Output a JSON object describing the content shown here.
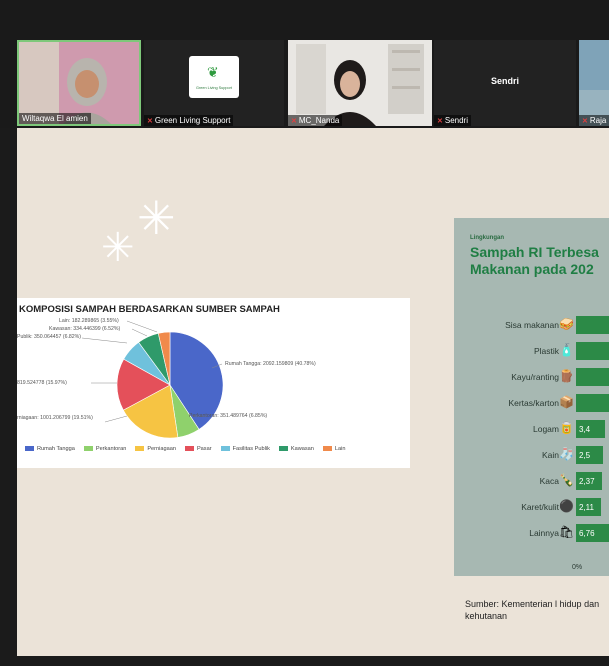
{
  "participants": [
    {
      "name": "Wiltaqwa El amien",
      "muted": false,
      "active": true
    },
    {
      "name": "Green Living Support",
      "muted": true,
      "logo_text": "Green Living Support"
    },
    {
      "name": "MC_Nanda",
      "muted": true
    },
    {
      "name": "Sendri",
      "muted": true,
      "center_label": "Sendri"
    },
    {
      "name": "Raja",
      "muted": true
    }
  ],
  "pie_chart": {
    "title": "KOMPOSISI SAMPAH BERDASARKAN SUMBER SAMPAH",
    "chart_data": {
      "type": "pie",
      "slices": [
        {
          "name": "Rumah Tangga",
          "value": 2092.159809,
          "percent": 40.78,
          "label": "Rumah Tangga: 2092.159809 (40.78%)",
          "color": "#4a67c9"
        },
        {
          "name": "Perkantoran",
          "value": 351.489764,
          "percent": 6.85,
          "label": "Perkantoran: 351.489764 (6.85%)",
          "color": "#8fd16c"
        },
        {
          "name": "Perniagaan",
          "value": 1001.206799,
          "percent": 19.51,
          "label": "rniagaan: 1001.206799 (19.51%)",
          "color": "#f6c443"
        },
        {
          "name": "Pasar",
          "value": 819.524778,
          "percent": 15.97,
          "label": "819.524778 (15.97%)",
          "color": "#e4505a"
        },
        {
          "name": "Fasilitas Publik",
          "value": 350.064457,
          "percent": 6.82,
          "label": "Publik: 350.064457 (6.82%)",
          "color": "#6fc1dc"
        },
        {
          "name": "Kawasan",
          "value": 334.446399,
          "percent": 6.52,
          "label": "Kawasan: 334.446399 (6.52%)",
          "color": "#2f9a6a"
        },
        {
          "name": "Lain",
          "value": 182.289865,
          "percent": 3.55,
          "label": "Lain: 182.289865 (3.55%)",
          "color": "#f08a4b"
        }
      ]
    }
  },
  "infographic": {
    "subtitle": "Lingkungan",
    "title_line1": "Sampah RI Terbesa",
    "title_line2": "Makanan pada 202",
    "axis_zero": "0%",
    "chart_data": {
      "type": "bar",
      "categories": [
        "Sisa makanan",
        "Plastik",
        "Kayu/ranting",
        "Kertas/karton",
        "Logam",
        "Kain",
        "Kaca",
        "Karet/kulit",
        "Lainnya"
      ],
      "values": [
        null,
        null,
        null,
        null,
        3.4,
        2.55,
        2.37,
        2.11,
        6.76
      ],
      "value_labels": [
        "",
        "",
        "",
        "",
        "3,4",
        "2,5",
        "2,37",
        "2,11",
        "6,76"
      ],
      "icons": [
        "food-icon",
        "bottle-icon",
        "branch-icon",
        "paper-icon",
        "can-icon",
        "cloth-icon",
        "glass-icon",
        "tire-icon",
        "trash-bag-icon"
      ]
    }
  },
  "source_text": "Sumber: Kementerian l hidup dan kehutanan"
}
